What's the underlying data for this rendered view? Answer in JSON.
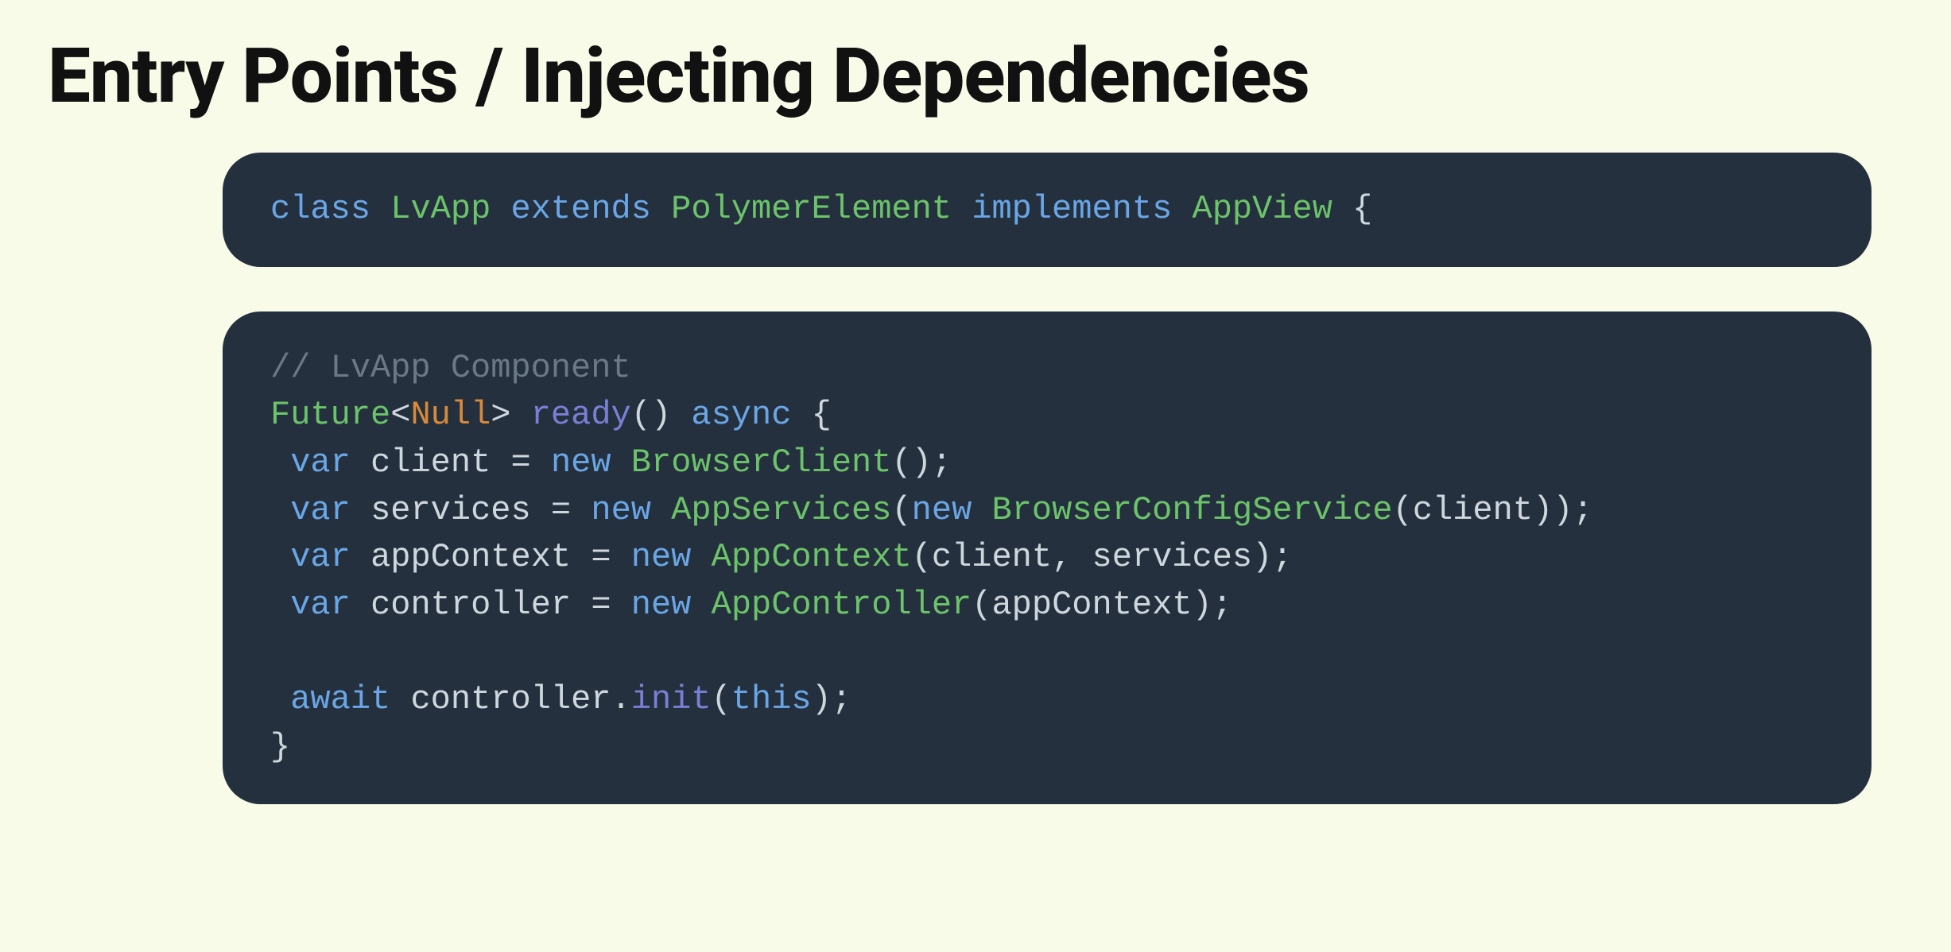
{
  "slide": {
    "title": "Entry Points / Injecting Dependencies"
  },
  "code1": {
    "tok": {
      "class": "class",
      "LvApp": "LvApp",
      "extends": "extends",
      "PolymerElement": "PolymerElement",
      "implements": "implements",
      "AppView": "AppView",
      "lbrace": "{"
    }
  },
  "code2": {
    "tok": {
      "comment": "// LvApp Component",
      "Future": "Future",
      "lt": "<",
      "Null": "Null",
      "gt": ">",
      "ready": "ready",
      "parens": "()",
      "async": "async",
      "lbrace": "{",
      "var1": "var",
      "client": "client",
      "eq": "=",
      "new1": "new",
      "BrowserClient": "BrowserClient",
      "browserClientCall": "();",
      "var2": "var",
      "services": "services",
      "new2": "new",
      "AppServices": "AppServices",
      "appServicesOpen": "(",
      "new3": "new",
      "BrowserConfigService": "BrowserConfigService",
      "bcsCall": "(client));",
      "var3": "var",
      "appContext": "appContext",
      "new4": "new",
      "AppContext": "AppContext",
      "appContextCall": "(client, services);",
      "var4": "var",
      "controller": "controller",
      "new5": "new",
      "AppController": "AppController",
      "appControllerCall": "(appContext);",
      "await": "await",
      "controllerRef": "controller",
      "dot": ".",
      "init": "init",
      "initCall": "(",
      "this": "this",
      "initClose": ");",
      "rbrace": "}"
    }
  }
}
